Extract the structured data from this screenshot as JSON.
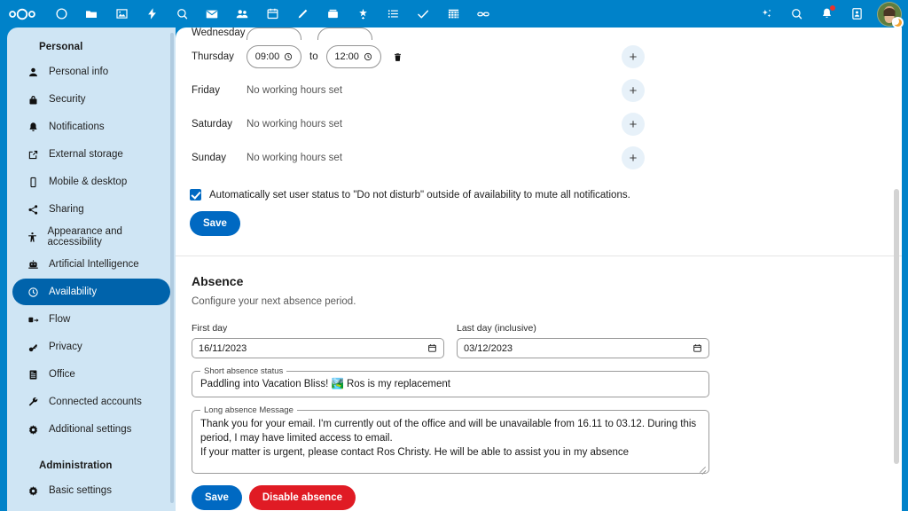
{
  "topbar": {
    "logo_name": "nextcloud-logo",
    "background": "#0082c9",
    "apps": [
      {
        "name": "app-dashboard",
        "icon": "circle-icon"
      },
      {
        "name": "app-files",
        "icon": "folder-icon"
      },
      {
        "name": "app-photos",
        "icon": "image-icon"
      },
      {
        "name": "app-activity",
        "icon": "lightning-icon"
      },
      {
        "name": "app-search",
        "icon": "magnifier-icon"
      },
      {
        "name": "app-mail",
        "icon": "envelope-icon"
      },
      {
        "name": "app-contacts",
        "icon": "people-icon"
      },
      {
        "name": "app-calendar",
        "icon": "calendar-icon"
      },
      {
        "name": "app-notes",
        "icon": "pencil-icon"
      },
      {
        "name": "app-deck",
        "icon": "deck-icon"
      },
      {
        "name": "app-assistant",
        "icon": "sparkle-star-icon"
      },
      {
        "name": "app-tasks",
        "icon": "list-icon"
      },
      {
        "name": "app-checks",
        "icon": "checkmark-icon"
      },
      {
        "name": "app-tables",
        "icon": "grid-table-icon"
      },
      {
        "name": "app-links",
        "icon": "link-icon"
      }
    ],
    "right": [
      {
        "name": "assistant-button",
        "icon": "sparkle-icon"
      },
      {
        "name": "unified-search-button",
        "icon": "search-icon"
      },
      {
        "name": "notifications-button",
        "icon": "bell-icon",
        "badge": true
      },
      {
        "name": "contacts-menu-button",
        "icon": "contacts-card-icon"
      }
    ],
    "avatar": {
      "name": "user-avatar",
      "status": "away"
    }
  },
  "sidebar": {
    "personal_heading": "Personal",
    "items": [
      {
        "label": "Personal info",
        "icon": "person-icon",
        "active": false
      },
      {
        "label": "Security",
        "icon": "lock-icon",
        "active": false
      },
      {
        "label": "Notifications",
        "icon": "bell-icon",
        "active": false
      },
      {
        "label": "External storage",
        "icon": "external-link-icon",
        "active": false
      },
      {
        "label": "Mobile & desktop",
        "icon": "phone-icon",
        "active": false
      },
      {
        "label": "Sharing",
        "icon": "share-icon",
        "active": false
      },
      {
        "label": "Appearance and accessibility",
        "icon": "accessibility-icon",
        "active": false
      },
      {
        "label": "Artificial Intelligence",
        "icon": "robot-icon",
        "active": false
      },
      {
        "label": "Availability",
        "icon": "clock-icon",
        "active": true
      },
      {
        "label": "Flow",
        "icon": "flow-icon",
        "active": false
      },
      {
        "label": "Privacy",
        "icon": "key-icon",
        "active": false
      },
      {
        "label": "Office",
        "icon": "document-icon",
        "active": false
      },
      {
        "label": "Connected accounts",
        "icon": "wrench-icon",
        "active": false
      },
      {
        "label": "Additional settings",
        "icon": "gear-icon",
        "active": false
      }
    ],
    "administration_heading": "Administration",
    "admin_items": [
      {
        "label": "Basic settings",
        "icon": "gear-icon",
        "active": false
      }
    ]
  },
  "working_hours": {
    "to_label": "to",
    "none_label": "No working hours set",
    "add_label": "+",
    "rows": [
      {
        "day": "Wednesday",
        "has_hours": true,
        "from": "",
        "to": "",
        "clipped": true
      },
      {
        "day": "Thursday",
        "has_hours": true,
        "from": "09:00",
        "to": "12:00",
        "clipped": false
      },
      {
        "day": "Friday",
        "has_hours": false,
        "clipped": false
      },
      {
        "day": "Saturday",
        "has_hours": false,
        "clipped": false
      },
      {
        "day": "Sunday",
        "has_hours": false,
        "clipped": false
      }
    ],
    "dnd_label": "Automatically set user status to \"Do not disturb\" outside of availability to mute all notifications.",
    "dnd_checked": true,
    "save_label": "Save"
  },
  "absence": {
    "title": "Absence",
    "subtitle": "Configure your next absence period.",
    "first_day_label": "First day",
    "first_day_value": "16/11/2023",
    "last_day_label": "Last day (inclusive)",
    "last_day_value": "03/12/2023",
    "short_status_legend": "Short absence status",
    "short_status_value": "Paddling into Vacation Bliss! 🏞️ Ros is my replacement",
    "long_message_legend": "Long absence Message",
    "long_message_line1": "Thank you for your email. I'm currently out of the office and will be unavailable from 16.11 to 03.12. During this period, I may have limited access to email.",
    "long_message_line2": "If your matter is urgent, please contact Ros Christy. He will be able to assist you in my absence",
    "save_label": "Save",
    "disable_label": "Disable absence",
    "primary_color": "#0069c2",
    "danger_color": "#e01b24"
  }
}
